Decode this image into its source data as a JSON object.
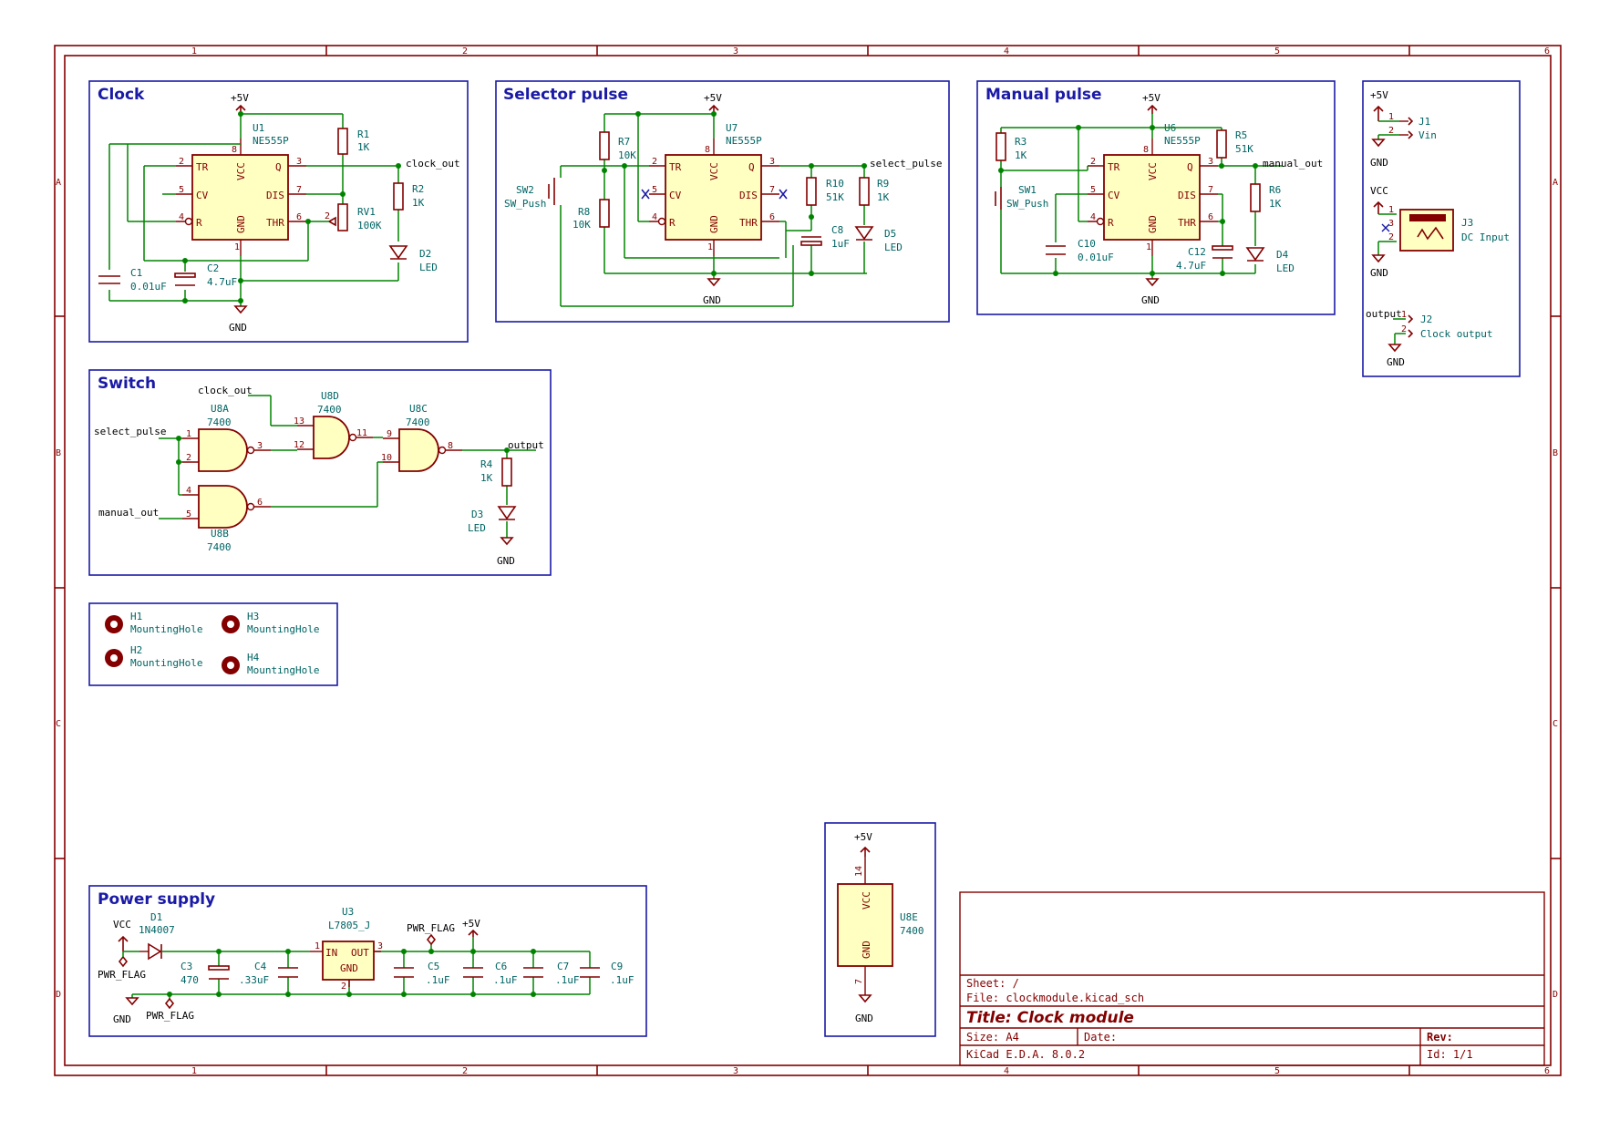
{
  "grid": {
    "columns": [
      "1",
      "2",
      "3",
      "4",
      "5",
      "6"
    ],
    "rows": [
      "A",
      "B",
      "C",
      "D"
    ]
  },
  "title_block": {
    "sheet": "Sheet: /",
    "file": "File: clockmodule.kicad_sch",
    "title": "Title: Clock module",
    "size": "Size: A4",
    "date": "Date:",
    "rev": "Rev:",
    "kicad": "KiCad E.D.A. 8.0.2",
    "id": "Id: 1/1"
  },
  "sections": {
    "clock": "Clock",
    "selector": "Selector pulse",
    "manual": "Manual pulse",
    "switch": "Switch",
    "power": "Power supply"
  },
  "chip555": {
    "tr": "TR",
    "cv": "CV",
    "r": "R",
    "vcc": "VCC",
    "q": "Q",
    "dis": "DIS",
    "thr": "THR",
    "gnd": "GND",
    "p1": "1",
    "p2": "2",
    "p3": "3",
    "p4": "4",
    "p5": "5",
    "p6": "6",
    "p7": "7",
    "p8": "8"
  },
  "clock": {
    "u": [
      "U1",
      "NE555P"
    ],
    "r1": [
      "R1",
      "1K"
    ],
    "r2": [
      "R2",
      "1K"
    ],
    "rv1": [
      "RV1",
      "100K"
    ],
    "d2": [
      "D2",
      "LED"
    ],
    "c1": [
      "C1",
      "0.01uF"
    ],
    "c2": [
      "C2",
      "4.7uF"
    ],
    "net": "clock_out",
    "vcc": "+5V",
    "gnd": "GND"
  },
  "selector": {
    "u": [
      "U7",
      "NE555P"
    ],
    "r7": [
      "R7",
      "10K"
    ],
    "r8": [
      "R8",
      "10K"
    ],
    "r10": [
      "R10",
      "51K"
    ],
    "r9": [
      "R9",
      "1K"
    ],
    "c8": [
      "C8",
      "1uF"
    ],
    "d5": [
      "D5",
      "LED"
    ],
    "sw": [
      "SW2",
      "SW_Push"
    ],
    "net": "select_pulse",
    "vcc": "+5V",
    "gnd": "GND"
  },
  "manual": {
    "u": [
      "U6",
      "NE555P"
    ],
    "r3": [
      "R3",
      "1K"
    ],
    "r5": [
      "R5",
      "51K"
    ],
    "r6": [
      "R6",
      "1K"
    ],
    "c10": [
      "C10",
      "0.01uF"
    ],
    "c12": [
      "C12",
      "4.7uF"
    ],
    "d4": [
      "D4",
      "LED"
    ],
    "sw": [
      "SW1",
      "SW_Push"
    ],
    "net": "manual_out",
    "vcc": "+5V",
    "gnd": "GND"
  },
  "connectors": {
    "vcc5": "+5V",
    "j1": [
      "J1",
      "Vin"
    ],
    "gnd": "GND",
    "vcc": "VCC",
    "j3": [
      "J3",
      "DC Input"
    ],
    "output": "output",
    "j2": [
      "J2",
      "Clock output"
    ],
    "pins": [
      "1",
      "2",
      "3"
    ]
  },
  "switch": {
    "u8a": [
      "U8A",
      "7400"
    ],
    "u8b": [
      "U8B",
      "7400"
    ],
    "u8c": [
      "U8C",
      "7400"
    ],
    "u8d": [
      "U8D",
      "7400"
    ],
    "r4": [
      "R4",
      "1K"
    ],
    "d3": [
      "D3",
      "LED"
    ],
    "nets": [
      "select_pulse",
      "manual_out",
      "clock_out",
      "output"
    ],
    "pins": [
      "1",
      "2",
      "3",
      "4",
      "5",
      "6",
      "9",
      "10",
      "8",
      "13",
      "12",
      "11"
    ],
    "gnd": "GND"
  },
  "holes": [
    [
      "H1",
      "MountingHole"
    ],
    [
      "H2",
      "MountingHole"
    ],
    [
      "H3",
      "MountingHole"
    ],
    [
      "H4",
      "MountingHole"
    ]
  ],
  "power": {
    "d1": [
      "D1",
      "1N4007"
    ],
    "u3": [
      "U3",
      "L7805_J"
    ],
    "c3": [
      "C3",
      "470"
    ],
    "c4": [
      "C4",
      ".33uF"
    ],
    "c5": [
      "C5",
      ".1uF"
    ],
    "c6": [
      "C6",
      ".1uF"
    ],
    "c7": [
      "C7",
      ".1uF"
    ],
    "c9": [
      "C9",
      ".1uF"
    ],
    "vcc": "VCC",
    "pwr_flag": "PWR_FLAG",
    "v5": "+5V",
    "gnd": "GND",
    "in": "IN",
    "out": "OUT",
    "gndpin": "GND",
    "pins": [
      "1",
      "2",
      "3"
    ]
  },
  "u8e": {
    "ref": [
      "U8E",
      "7400"
    ],
    "vcc": "VCC",
    "gndlbl": "GND",
    "v5": "+5V",
    "gnd": "GND",
    "pins": [
      "14",
      "7"
    ]
  },
  "colors": {
    "frame": "#840000",
    "wire": "#008400",
    "sheet_box": "#1a1aa6",
    "body_fill": "#ffffc2",
    "ref_text": "#006464"
  }
}
